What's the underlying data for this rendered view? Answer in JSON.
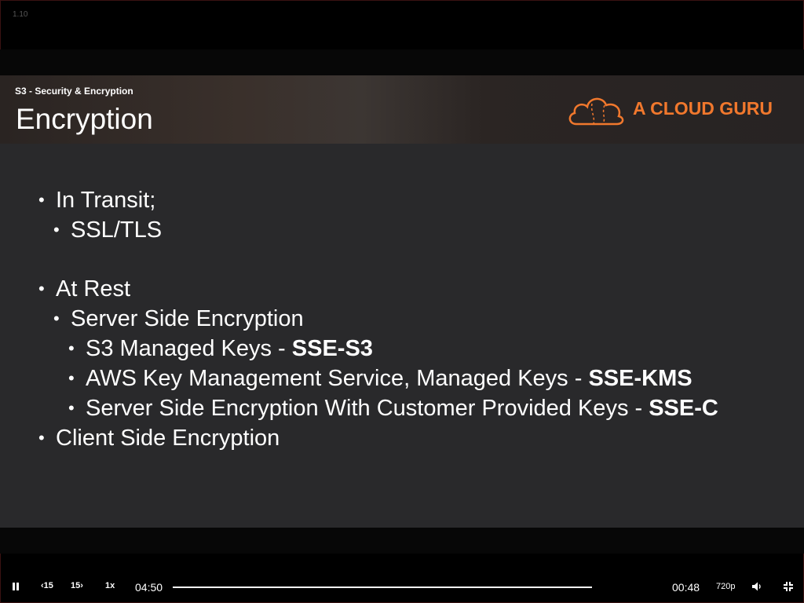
{
  "version_label": "1.10",
  "slide": {
    "section": "S3 - Security & Encryption",
    "title": "Encryption",
    "logo_text": "A CLOUD GURU",
    "bullets": [
      {
        "text": "In Transit;",
        "bold": ""
      },
      {
        "text": "SSL/TLS",
        "bold": ""
      },
      {
        "text": "At Rest",
        "bold": ""
      },
      {
        "text": "Server Side Encryption",
        "bold": ""
      },
      {
        "text": "S3 Managed Keys - ",
        "bold": "SSE-S3"
      },
      {
        "text": "AWS Key Management Service, Managed Keys - ",
        "bold": "SSE-KMS"
      },
      {
        "text": "Server Side Encryption With Customer Provided Keys - ",
        "bold": "SSE-C"
      },
      {
        "text": "Client Side Encryption",
        "bold": ""
      }
    ]
  },
  "player": {
    "pause_icon": "pause-icon",
    "rewind_label": "15",
    "forward_label": "15",
    "speed": "1x",
    "current_time": "04:50",
    "remaining_time": "00:48",
    "progress": 1.0,
    "quality": "720p",
    "volume_icon": "volume-icon",
    "fullscreen_icon": "exit-fullscreen-icon"
  },
  "colors": {
    "accent": "#f1782d",
    "slide_bg": "#29292b"
  }
}
